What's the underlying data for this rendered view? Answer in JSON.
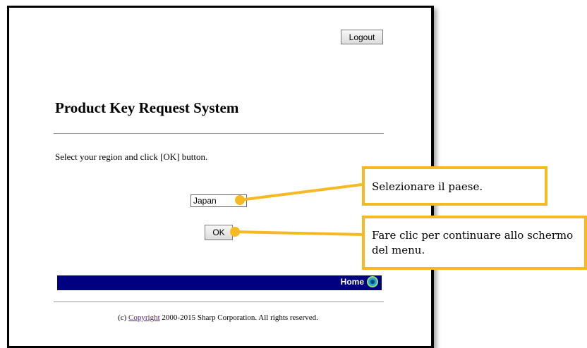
{
  "header": {
    "logout_label": "Logout"
  },
  "main": {
    "title": "Product Key Request System",
    "instruction": "Select your region and click [OK] button.",
    "region_select": {
      "selected": "Japan"
    },
    "ok_label": "OK"
  },
  "navbar": {
    "home_label": "Home"
  },
  "footer": {
    "prefix": "(c) ",
    "link": "Copyright",
    "suffix": " 2000-2015 Sharp Corporation. All rights reserved."
  },
  "callouts": {
    "select_country": "Selezionare il paese.",
    "continue_menu": "Fare clic per continuare allo schermo del menu."
  },
  "colors": {
    "callout_border": "#f5b921",
    "navbar_bg": "#000080"
  }
}
